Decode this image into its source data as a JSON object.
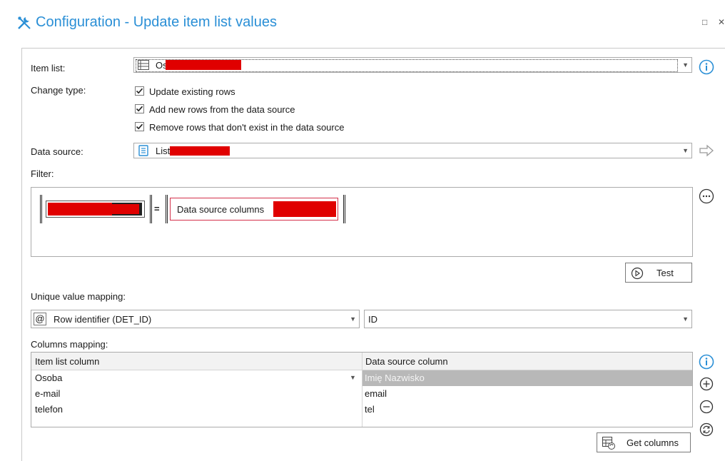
{
  "dialog": {
    "title": "Configuration - Update item list values",
    "title_icon": "tools-icon",
    "accent_color": "#2a8fd6"
  },
  "form": {
    "item_list_label": "Item list:",
    "item_list_value_prefix": "Os",
    "change_type_label": "Change type:",
    "checkboxes": [
      {
        "label": "Update existing rows",
        "checked": true
      },
      {
        "label": "Add new rows from the data source",
        "checked": true
      },
      {
        "label": "Remove rows that don't exist in the data source",
        "checked": true
      }
    ],
    "data_source_label": "Data source:",
    "data_source_value_prefix": "List",
    "filter_label": "Filter:",
    "filter_operator": "=",
    "filter_right_label": "Data source columns",
    "test_button": "Test",
    "unique_mapping_label": "Unique value mapping:",
    "unique_left_value": "Row identifier (DET_ID)",
    "unique_right_value": "ID",
    "columns_mapping_label": "Columns mapping:",
    "get_columns_button": "Get columns"
  },
  "columns_table": {
    "headers": [
      "Item list column",
      "Data source column"
    ],
    "rows": [
      {
        "item": "Osoba",
        "source": "Imię Nazwisko",
        "selected": true
      },
      {
        "item": "e-mail",
        "source": "email",
        "selected": false
      },
      {
        "item": "telefon",
        "source": "tel",
        "selected": false
      }
    ]
  },
  "icons": {
    "info": "info-icon",
    "more": "ellipsis-icon",
    "add": "plus-circle-icon",
    "remove": "minus-circle-icon",
    "refresh": "refresh-icon",
    "arrow": "arrow-right-icon"
  }
}
